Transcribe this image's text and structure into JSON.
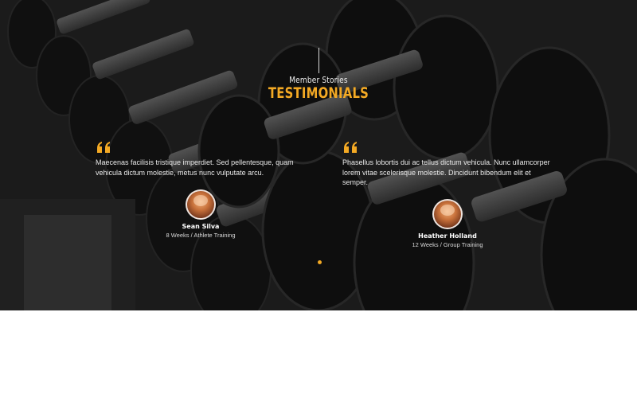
{
  "section": {
    "eyebrow": "Member Stories",
    "title": "TESTIMONIALS"
  },
  "colors": {
    "accent": "#f3a924",
    "text_light": "#e9e9e9",
    "background_below": "#ffffff"
  },
  "testimonials": [
    {
      "quote_icon": "quote-icon",
      "text": "Maecenas facilisis tristique imperdiet. Sed pellentesque, quam vehicula dictum molestie, metus nunc vulputate arcu.",
      "author_name": "Sean Silva",
      "author_program": "8 Weeks / Athlete Training",
      "avatar": "avatar"
    },
    {
      "quote_icon": "quote-icon",
      "text": "Phasellus lobortis dui ac tellus dictum vehicula. Nunc ullamcorper lorem vitae scelerisque molestie. Dincidunt bibendum elit et semper.",
      "author_name": "Heather Holland",
      "author_program": "12 Weeks / Group Training",
      "avatar": "avatar"
    }
  ],
  "slider": {
    "dots": 1,
    "active_index": 0
  }
}
